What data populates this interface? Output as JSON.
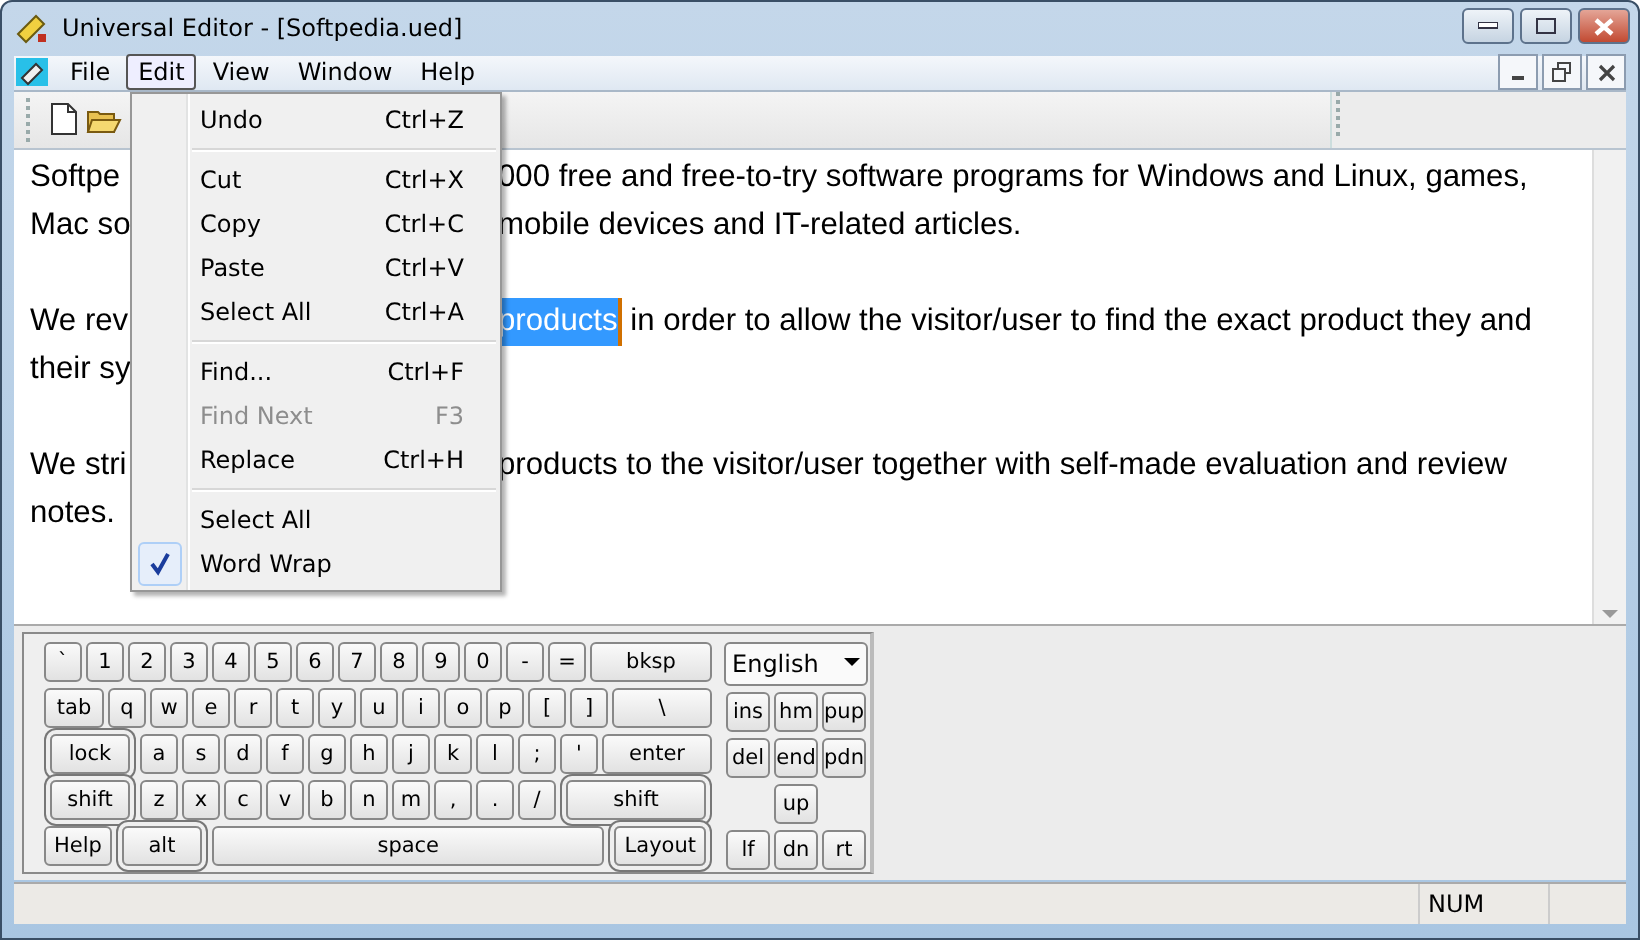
{
  "window": {
    "title": "Universal Editor - [Softpedia.ued]"
  },
  "menu_bar": [
    {
      "label": "File",
      "selected": false
    },
    {
      "label": "Edit",
      "selected": true
    },
    {
      "label": "View",
      "selected": false
    },
    {
      "label": "Window",
      "selected": false
    },
    {
      "label": "Help",
      "selected": false
    }
  ],
  "edit_menu": [
    {
      "kind": "item",
      "label": "Undo",
      "shortcut": "Ctrl+Z",
      "checked": false,
      "disabled": false
    },
    {
      "kind": "separator"
    },
    {
      "kind": "item",
      "label": "Cut",
      "shortcut": "Ctrl+X",
      "checked": false,
      "disabled": false
    },
    {
      "kind": "item",
      "label": "Copy",
      "shortcut": "Ctrl+C",
      "checked": false,
      "disabled": false
    },
    {
      "kind": "item",
      "label": "Paste",
      "shortcut": "Ctrl+V",
      "checked": false,
      "disabled": false
    },
    {
      "kind": "item",
      "label": "Select All",
      "shortcut": "Ctrl+A",
      "checked": false,
      "disabled": false
    },
    {
      "kind": "separator"
    },
    {
      "kind": "item",
      "label": "Find...",
      "shortcut": "Ctrl+F",
      "checked": false,
      "disabled": false
    },
    {
      "kind": "item",
      "label": "Find Next",
      "shortcut": "F3",
      "checked": false,
      "disabled": true
    },
    {
      "kind": "item",
      "label": "Replace",
      "shortcut": "Ctrl+H",
      "checked": false,
      "disabled": false
    },
    {
      "kind": "separator"
    },
    {
      "kind": "item",
      "label": "Select All",
      "checked": false,
      "disabled": false
    },
    {
      "kind": "item",
      "label": "Word Wrap",
      "checked": true,
      "disabled": false
    }
  ],
  "editor": {
    "paragraphs": [
      {
        "lines": [
          {
            "left": "Softpe",
            "right": [
              {
                "text": "000 free and free-to-try software programs for Windows and Linux, games,",
                "selected": false
              }
            ]
          },
          {
            "left": "Mac so",
            "right": [
              {
                "text": "mobile devices and IT-related articles.",
                "selected": false
              }
            ]
          }
        ]
      },
      {
        "lines": [
          {
            "left": "We rev",
            "right": [
              {
                "text": "products",
                "selected": true
              },
              {
                "text": " in order to allow the visitor/user to find the exact product they and",
                "selected": false
              }
            ]
          },
          {
            "left": "their sy"
          }
        ]
      },
      {
        "lines": [
          {
            "left": "We stri",
            "right": [
              {
                "text": "products to the visitor/user together with self-made evaluation and review",
                "selected": false
              }
            ]
          },
          {
            "left": "notes."
          }
        ]
      }
    ]
  },
  "keyboard": {
    "rows": [
      {
        "keys": [
          {
            "label": "`",
            "kind": "char"
          },
          {
            "label": "1",
            "kind": "char"
          },
          {
            "label": "2",
            "kind": "char"
          },
          {
            "label": "3",
            "kind": "char"
          },
          {
            "label": "4",
            "kind": "char"
          },
          {
            "label": "5",
            "kind": "char"
          },
          {
            "label": "6",
            "kind": "char"
          },
          {
            "label": "7",
            "kind": "char"
          },
          {
            "label": "8",
            "kind": "char"
          },
          {
            "label": "9",
            "kind": "char"
          },
          {
            "label": "0",
            "kind": "char"
          },
          {
            "label": "-",
            "kind": "char"
          },
          {
            "label": "=",
            "kind": "char"
          },
          {
            "label": "bksp",
            "kind": "fn"
          }
        ]
      },
      {
        "keys": [
          {
            "label": "tab",
            "kind": "fn"
          },
          {
            "label": "q",
            "kind": "char"
          },
          {
            "label": "w",
            "kind": "char"
          },
          {
            "label": "e",
            "kind": "char"
          },
          {
            "label": "r",
            "kind": "char"
          },
          {
            "label": "t",
            "kind": "char"
          },
          {
            "label": "y",
            "kind": "char"
          },
          {
            "label": "u",
            "kind": "char"
          },
          {
            "label": "i",
            "kind": "char"
          },
          {
            "label": "o",
            "kind": "char"
          },
          {
            "label": "p",
            "kind": "char"
          },
          {
            "label": "[",
            "kind": "char"
          },
          {
            "label": "]",
            "kind": "char"
          },
          {
            "label": "\\",
            "kind": "fn"
          }
        ]
      },
      {
        "keys": [
          {
            "label": "lock",
            "kind": "toggle"
          },
          {
            "label": "a",
            "kind": "char"
          },
          {
            "label": "s",
            "kind": "char"
          },
          {
            "label": "d",
            "kind": "char"
          },
          {
            "label": "f",
            "kind": "char"
          },
          {
            "label": "g",
            "kind": "char"
          },
          {
            "label": "h",
            "kind": "char"
          },
          {
            "label": "j",
            "kind": "char"
          },
          {
            "label": "k",
            "kind": "char"
          },
          {
            "label": "l",
            "kind": "char"
          },
          {
            "label": ";",
            "kind": "char"
          },
          {
            "label": "'",
            "kind": "char"
          },
          {
            "label": "enter",
            "kind": "fn"
          }
        ]
      },
      {
        "keys": [
          {
            "label": "shift",
            "kind": "toggle"
          },
          {
            "label": "z",
            "kind": "char"
          },
          {
            "label": "x",
            "kind": "char"
          },
          {
            "label": "c",
            "kind": "char"
          },
          {
            "label": "v",
            "kind": "char"
          },
          {
            "label": "b",
            "kind": "char"
          },
          {
            "label": "n",
            "kind": "char"
          },
          {
            "label": "m",
            "kind": "char"
          },
          {
            "label": ",",
            "kind": "char"
          },
          {
            "label": ".",
            "kind": "char"
          },
          {
            "label": "/",
            "kind": "char"
          },
          {
            "label": "shift",
            "kind": "toggle"
          }
        ]
      },
      {
        "keys": [
          {
            "label": "Help",
            "kind": "fn"
          },
          {
            "label": "alt",
            "kind": "toggle"
          },
          {
            "label": "space",
            "kind": "space"
          },
          {
            "label": "Layout",
            "kind": "toggle"
          }
        ]
      }
    ],
    "language": "English",
    "nav_rows": [
      {
        "keys": [
          "ins",
          "hm",
          "pup"
        ]
      },
      {
        "keys": [
          "del",
          "end",
          "pdn"
        ]
      },
      {
        "keys": [
          "up"
        ]
      },
      {
        "keys": [
          "lf",
          "dn",
          "rt"
        ]
      }
    ]
  },
  "status_bar": {
    "indicator": "NUM"
  }
}
